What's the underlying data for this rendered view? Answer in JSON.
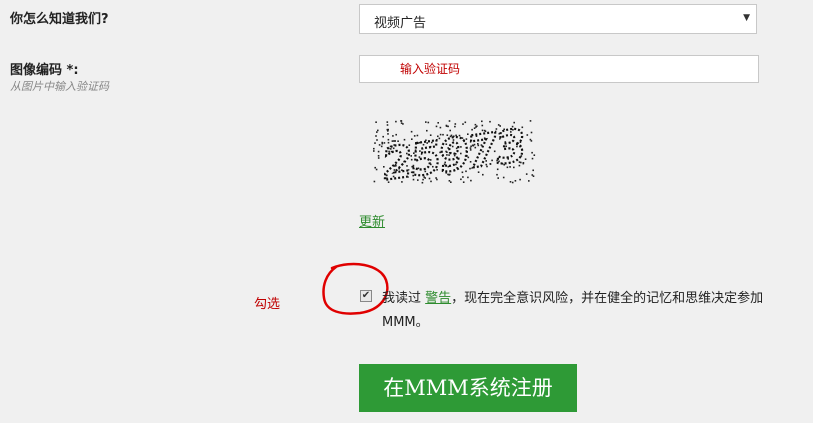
{
  "source": {
    "label": "你怎么知道我们?",
    "selected": "视频广告"
  },
  "captcha": {
    "label": "图像编码 *:",
    "hint": "从图片中输入验证码",
    "input_annotation": "输入验证码",
    "image_text": "25973",
    "refresh_label": "更新"
  },
  "agreement": {
    "annotation": "勾选",
    "checked": true,
    "check_mark": "✔",
    "prefix": "我读过",
    "link": "警告",
    "suffix": "，现在完全意识风险，并在健全的记忆和思维决定参加MMM。"
  },
  "register": {
    "label": "在MMM系统注册"
  },
  "colors": {
    "accent_green": "#2e9a36",
    "annotation_red": "#c00000"
  },
  "icons": {
    "select_arrow": "▼"
  }
}
